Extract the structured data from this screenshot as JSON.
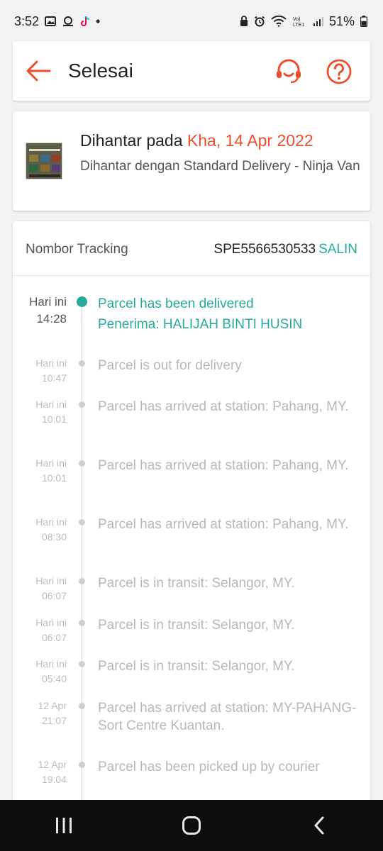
{
  "status_bar": {
    "time": "3:52",
    "dot": "•",
    "battery": "51%",
    "left_icons": [
      "image-icon",
      "podcast-icon",
      "tiktok-icon"
    ],
    "right_icons": [
      "lock-icon",
      "alarm-icon",
      "wifi-icon",
      "volte-icon",
      "signal-icon",
      "battery-icon"
    ]
  },
  "header": {
    "title": "Selesai",
    "back_icon": "arrow-left-icon",
    "support_icon": "headset-icon",
    "help_icon": "question-icon"
  },
  "delivery": {
    "prefix": "Dihantar pada ",
    "date": "Kha, 14 Apr 2022",
    "method": "Dihantar dengan Standard Delivery - Ninja Van"
  },
  "tracking": {
    "label": "Nombor Tracking",
    "number": "SPE5566530533",
    "copy_label": "SALIN"
  },
  "events": [
    {
      "day": "Hari ini",
      "time": "14:28",
      "text": "Parcel has been delivered",
      "subtext": "Penerima: HALIJAH BINTI HUSIN"
    },
    {
      "day": "Hari ini",
      "time": "10:47",
      "text": "Parcel is out for delivery"
    },
    {
      "day": "Hari ini",
      "time": "10:01",
      "text": "Parcel has arrived at station: Pahang, MY."
    },
    {
      "day": "Hari ini",
      "time": "10:01",
      "text": "Parcel has arrived at station: Pahang, MY."
    },
    {
      "day": "Hari ini",
      "time": "08:30",
      "text": "Parcel has arrived at station: Pahang, MY."
    },
    {
      "day": "Hari ini",
      "time": "06:07",
      "text": "Parcel is in transit: Selangor, MY."
    },
    {
      "day": "Hari ini",
      "time": "06:07",
      "text": "Parcel is in transit: Selangor, MY."
    },
    {
      "day": "Hari ini",
      "time": "05:40",
      "text": "Parcel is in transit: Selangor, MY."
    },
    {
      "day": "12 Apr",
      "time": "21:07",
      "text": "Parcel has arrived at station: MY-PAHANG-Sort Centre Kuantan."
    },
    {
      "day": "12 Apr",
      "time": "19:04",
      "text": "Parcel has been picked up by courier"
    }
  ],
  "colors": {
    "accent": "#ee4d2d",
    "teal": "#26aa99",
    "muted": "#b8b8b8"
  },
  "nav": {
    "icons": [
      "recents-icon",
      "home-icon",
      "back-icon"
    ]
  }
}
